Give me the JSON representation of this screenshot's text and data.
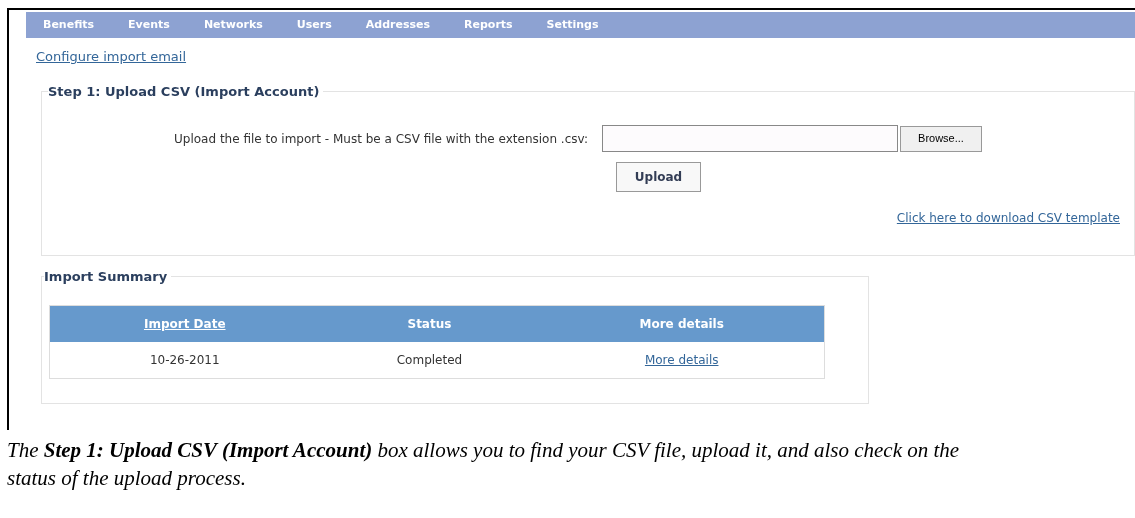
{
  "nav": {
    "items": [
      "Benefits",
      "Events",
      "Networks",
      "Users",
      "Addresses",
      "Reports",
      "Settings"
    ]
  },
  "configure_link": "Configure import email",
  "step1": {
    "legend": "Step 1: Upload CSV (Import Account)",
    "file_label": "Upload the file to import - Must be a CSV file with the extension .csv:",
    "browse_button": "Browse...",
    "upload_button": "Upload",
    "template_link": "Click here to download CSV template"
  },
  "summary": {
    "legend": "Import Summary",
    "columns": [
      {
        "label": "Import Date",
        "sortable": true
      },
      {
        "label": "Status",
        "sortable": false
      },
      {
        "label": "More details",
        "sortable": false
      }
    ],
    "rows": [
      {
        "date": "10-26-2011",
        "status": "Completed",
        "details": "More details"
      }
    ]
  },
  "caption": "The **Step 1: Upload CSV (Import Account)** box allows you to find your CSV file, upload it, and also check on the status of the upload process."
}
